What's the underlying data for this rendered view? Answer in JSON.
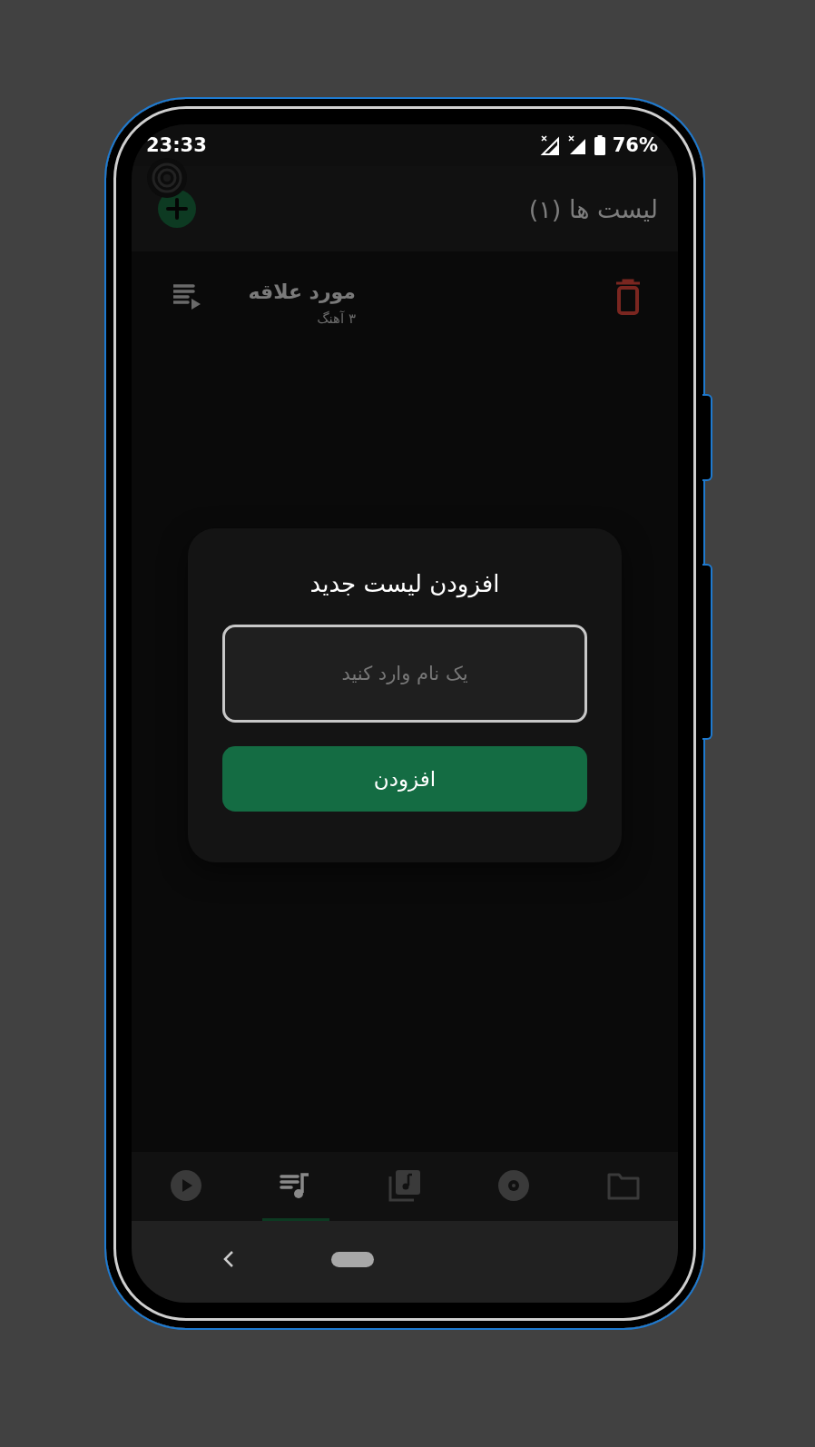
{
  "status_bar": {
    "time": "23:33",
    "battery": "76%"
  },
  "header": {
    "title": "لیست ها (۱)"
  },
  "playlists": [
    {
      "name": "مورد علاقه",
      "count": "۳ آهنگ"
    }
  ],
  "dialog": {
    "title": "افزودن لیست جدید",
    "field": {
      "placeholder": "یک نام وارد کنید"
    },
    "button": "افزودن"
  },
  "bottom_nav": [
    {
      "kind": "play",
      "selected": false
    },
    {
      "kind": "playlist",
      "selected": true
    },
    {
      "kind": "albums",
      "selected": false
    },
    {
      "kind": "disc",
      "selected": false
    },
    {
      "kind": "folder",
      "selected": false
    }
  ]
}
